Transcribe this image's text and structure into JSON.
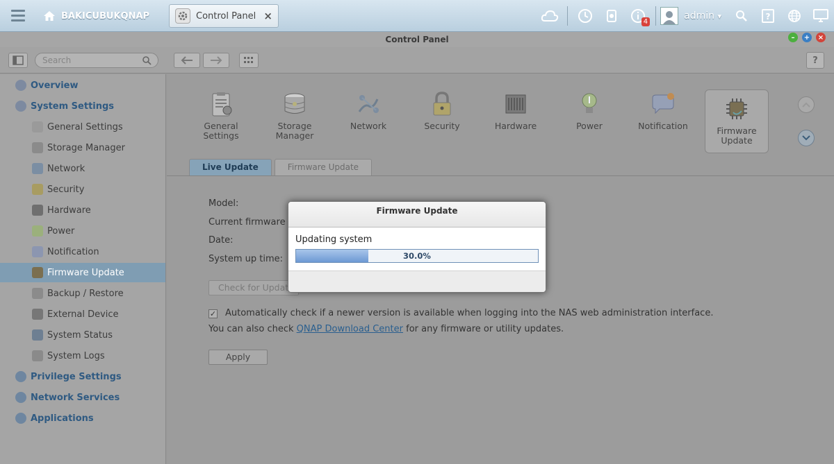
{
  "topbar": {
    "nas_name": "BAKICUBUKQNAP",
    "tab_label": "Control Panel",
    "tab_close": "×",
    "notification_count": "4",
    "user": "admin",
    "user_caret": "▾"
  },
  "window": {
    "title": "Control Panel"
  },
  "toolbar": {
    "search_placeholder": "Search",
    "help": "?"
  },
  "sidebar": {
    "items": [
      {
        "label": "Overview",
        "level": "top",
        "icon": "overview-icon"
      },
      {
        "label": "System Settings",
        "level": "top",
        "icon": "gear-icon"
      },
      {
        "label": "General Settings",
        "level": "sub",
        "icon": "clipboard-icon"
      },
      {
        "label": "Storage Manager",
        "level": "sub",
        "icon": "storage-icon"
      },
      {
        "label": "Network",
        "level": "sub",
        "icon": "network-icon"
      },
      {
        "label": "Security",
        "level": "sub",
        "icon": "lock-icon"
      },
      {
        "label": "Hardware",
        "level": "sub",
        "icon": "hardware-icon"
      },
      {
        "label": "Power",
        "level": "sub",
        "icon": "bulb-icon"
      },
      {
        "label": "Notification",
        "level": "sub",
        "icon": "notification-icon"
      },
      {
        "label": "Firmware Update",
        "level": "sub",
        "icon": "chip-icon",
        "active": true
      },
      {
        "label": "Backup / Restore",
        "level": "sub",
        "icon": "backup-icon"
      },
      {
        "label": "External Device",
        "level": "sub",
        "icon": "external-device-icon"
      },
      {
        "label": "System Status",
        "level": "sub",
        "icon": "monitor-icon"
      },
      {
        "label": "System Logs",
        "level": "sub",
        "icon": "logs-icon"
      },
      {
        "label": "Privilege Settings",
        "level": "top",
        "icon": "user-icon"
      },
      {
        "label": "Network Services",
        "level": "top",
        "icon": "globe-icon"
      },
      {
        "label": "Applications",
        "level": "top",
        "icon": "applications-icon"
      }
    ]
  },
  "categories": [
    {
      "line1": "General",
      "line2": "Settings"
    },
    {
      "line1": "Storage",
      "line2": "Manager"
    },
    {
      "line1": "Network",
      "line2": ""
    },
    {
      "line1": "Security",
      "line2": ""
    },
    {
      "line1": "Hardware",
      "line2": ""
    },
    {
      "line1": "Power",
      "line2": ""
    },
    {
      "line1": "Notification",
      "line2": ""
    },
    {
      "line1": "Firmware",
      "line2": "Update"
    }
  ],
  "subtabs": {
    "live_update": "Live Update",
    "firmware_update": "Firmware Update"
  },
  "info": {
    "model_label": "Model:",
    "current_fw_label": "Current firmware v",
    "date_label": "Date:",
    "uptime_label": "System up time:"
  },
  "check_button": "Check for Updat",
  "auto_check": {
    "checked": true,
    "check_mark": "✓",
    "text": "Automatically check if a newer version is available when logging into the NAS web administration interface."
  },
  "also_check": {
    "before": "You can also check ",
    "link": "QNAP Download Center",
    "after": " for any firmware or utility updates."
  },
  "apply_button": "Apply",
  "modal": {
    "title": "Firmware Update",
    "message": "Updating system",
    "progress_percent": 30.0,
    "progress_label": "30.0%"
  },
  "colors": {
    "accent": "#7f9db3",
    "link": "#2a5f8f",
    "progress_fill": "#6d99d4",
    "badge": "#d9413a"
  }
}
